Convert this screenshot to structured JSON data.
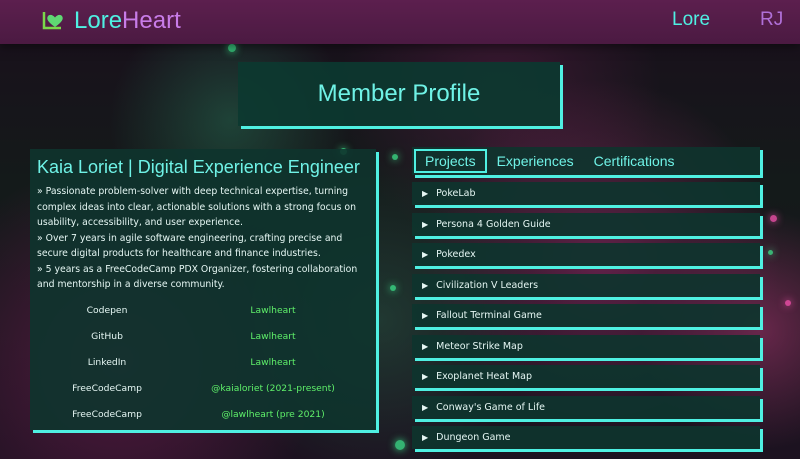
{
  "header": {
    "logo_lore": "Lore",
    "logo_heart": "Heart",
    "nav_lore": "Lore",
    "user_initials": "RJ"
  },
  "title": "Member Profile",
  "profile": {
    "name": "Kaia Loriet | Digital Experience Engineer",
    "bio": [
      "» Passionate problem-solver with deep technical expertise, turning complex ideas into clear, actionable solutions with a strong focus on usability, accessibility, and user experience.",
      "» Over 7 years in agile software engineering, crafting precise and secure digital products for healthcare and finance industries.",
      "» 5 years as a FreeCodeCamp PDX Organizer, fostering collaboration and mentorship in a diverse community."
    ],
    "links": [
      {
        "site": "Codepen",
        "handle": "Lawlheart"
      },
      {
        "site": "GitHub",
        "handle": "Lawlheart"
      },
      {
        "site": "LinkedIn",
        "handle": "Lawlheart"
      },
      {
        "site": "FreeCodeCamp",
        "handle": "@kaialoriet (2021-present)"
      },
      {
        "site": "FreeCodeCamp",
        "handle": "@lawlheart (pre 2021)"
      }
    ]
  },
  "tabs": [
    "Projects",
    "Experiences",
    "Certifications"
  ],
  "active_tab": "Projects",
  "projects": [
    "PokeLab",
    "Persona 4 Golden Guide",
    "Pokedex",
    "Civilization V Leaders",
    "Fallout Terminal Game",
    "Meteor Strike Map",
    "Exoplanet Heat Map",
    "Conway's Game of Life",
    "Dungeon Game"
  ],
  "colors": {
    "accent": "#4ff0e2",
    "brand_purple": "#c87ce8",
    "link_green": "#5ff06a",
    "header_bg": "#5c1f4e"
  }
}
